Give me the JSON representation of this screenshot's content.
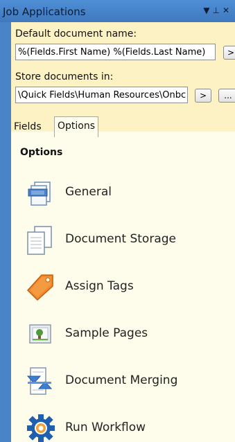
{
  "window": {
    "title": "Job Applications"
  },
  "config": {
    "doc_name_label": "Default document name:",
    "doc_name_value": "%(Fields.First Name) %(Fields.Last Name)",
    "store_label": "Store documents in:",
    "store_value": "\\Quick Fields\\Human Resources\\Onbc",
    "arrow_btn": ">",
    "browse_btn": "..."
  },
  "tabs": [
    {
      "label": "Fields"
    },
    {
      "label": "Options"
    }
  ],
  "options": {
    "heading": "Options",
    "items": [
      {
        "label": "General",
        "icon": "general-settings-icon"
      },
      {
        "label": "Document Storage",
        "icon": "document-storage-icon"
      },
      {
        "label": "Assign Tags",
        "icon": "tag-icon"
      },
      {
        "label": "Sample Pages",
        "icon": "sample-page-icon"
      },
      {
        "label": "Document Merging",
        "icon": "merge-icon"
      },
      {
        "label": "Run Workflow",
        "icon": "workflow-gear-icon"
      }
    ]
  }
}
